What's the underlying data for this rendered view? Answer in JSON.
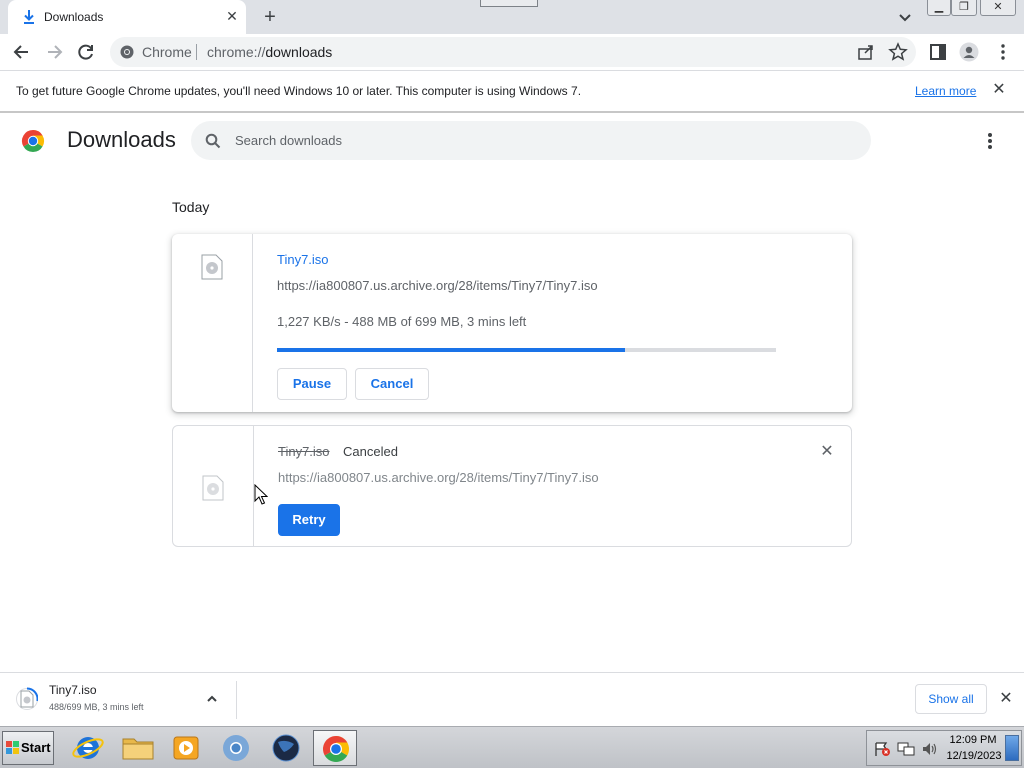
{
  "browser": {
    "tab": {
      "title": "Downloads"
    },
    "omnibox": {
      "site_label": "Chrome",
      "url_scheme": "chrome://",
      "url_path": "downloads"
    }
  },
  "infobar": {
    "message": "To get future Google Chrome updates, you'll need Windows 10 or later. This computer is using Windows 7.",
    "link": "Learn more"
  },
  "downloads_page": {
    "title": "Downloads",
    "search_placeholder": "Search downloads",
    "section": "Today",
    "items": [
      {
        "filename": "Tiny7.iso",
        "url": "https://ia800807.us.archive.org/28/items/Tiny7/Tiny7.iso",
        "progress_text": "1,227 KB/s - 488 MB of 699 MB, 3 mins left",
        "progress_fraction": 0.6981,
        "buttons": {
          "pause": "Pause",
          "cancel": "Cancel"
        }
      },
      {
        "filename": "Tiny7.iso",
        "status": "Canceled",
        "url": "https://ia800807.us.archive.org/28/items/Tiny7/Tiny7.iso",
        "buttons": {
          "retry": "Retry"
        }
      }
    ]
  },
  "shelf": {
    "item": {
      "filename": "Tiny7.iso",
      "status": "488/699 MB, 3 mins left"
    },
    "show_all": "Show all"
  },
  "taskbar": {
    "start_label": "Start",
    "apps": [
      "internet-explorer-icon",
      "folder-icon",
      "media-player-icon",
      "chromium-icon",
      "globe-icon",
      "chrome-icon"
    ],
    "clock": {
      "time": "12:09 PM",
      "date": "12/19/2023"
    }
  },
  "colors": {
    "accent": "#1a73e8",
    "text": "#202124",
    "secondary": "#5f6368"
  }
}
